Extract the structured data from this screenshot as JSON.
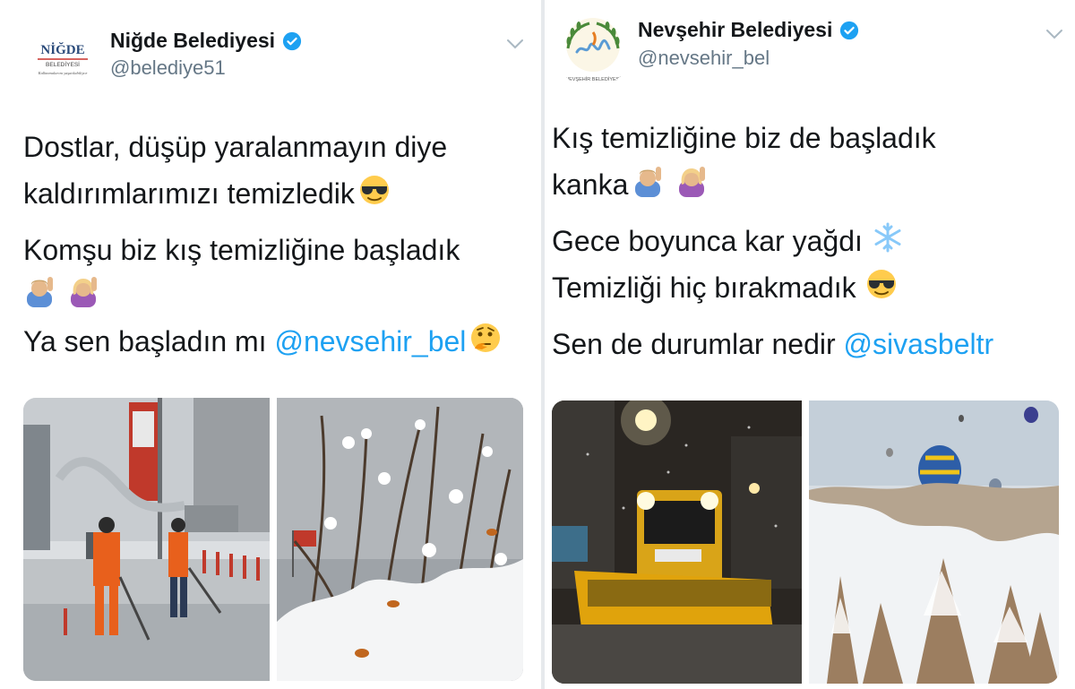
{
  "left_tweet": {
    "display_name": "Niğde Belediyesi",
    "handle": "@belediye51",
    "avatar": {
      "logo_text": "NİĞDE",
      "logo_sub": "BELEDİYESİ",
      "logo_slogan": "Kalkınmalarını yaşatılabiliyor"
    },
    "lines": [
      "Dostlar, düşüp yaralanmayın diye",
      "kaldırımlarımızı temizledik",
      "Komşu biz kış temizliğine başladık",
      "Ya sen başladın mı"
    ],
    "mention": "@nevsehir_bel",
    "photos": [
      "street-snow-cleaning-photo",
      "snowy-branches-photo"
    ]
  },
  "right_tweet": {
    "display_name": "Nevşehir Belediyesi",
    "handle": "@nevsehir_bel",
    "avatar": {
      "logo_sub": "NEVŞEHİR BELEDİYESİ"
    },
    "lines": [
      "Kış temizliğine biz de başladık",
      "kanka",
      "Gece boyunca kar yağdı",
      "Temizliği hiç bırakmadık",
      "Sen de durumlar nedir"
    ],
    "mention": "@sivasbeltr",
    "photos": [
      "snowplow-night-photo",
      "cappadocia-balloons-photo"
    ]
  },
  "colors": {
    "mention": "#1da1f2",
    "verified": "#1da1f2",
    "handle": "#657786",
    "text": "#14171a"
  },
  "icons": [
    "verified-badge-icon",
    "chevron-down-icon",
    "sunglasses-emoji-icon",
    "raising-hand-emoji-icon",
    "thinking-emoji-icon",
    "snowflake-emoji-icon"
  ]
}
